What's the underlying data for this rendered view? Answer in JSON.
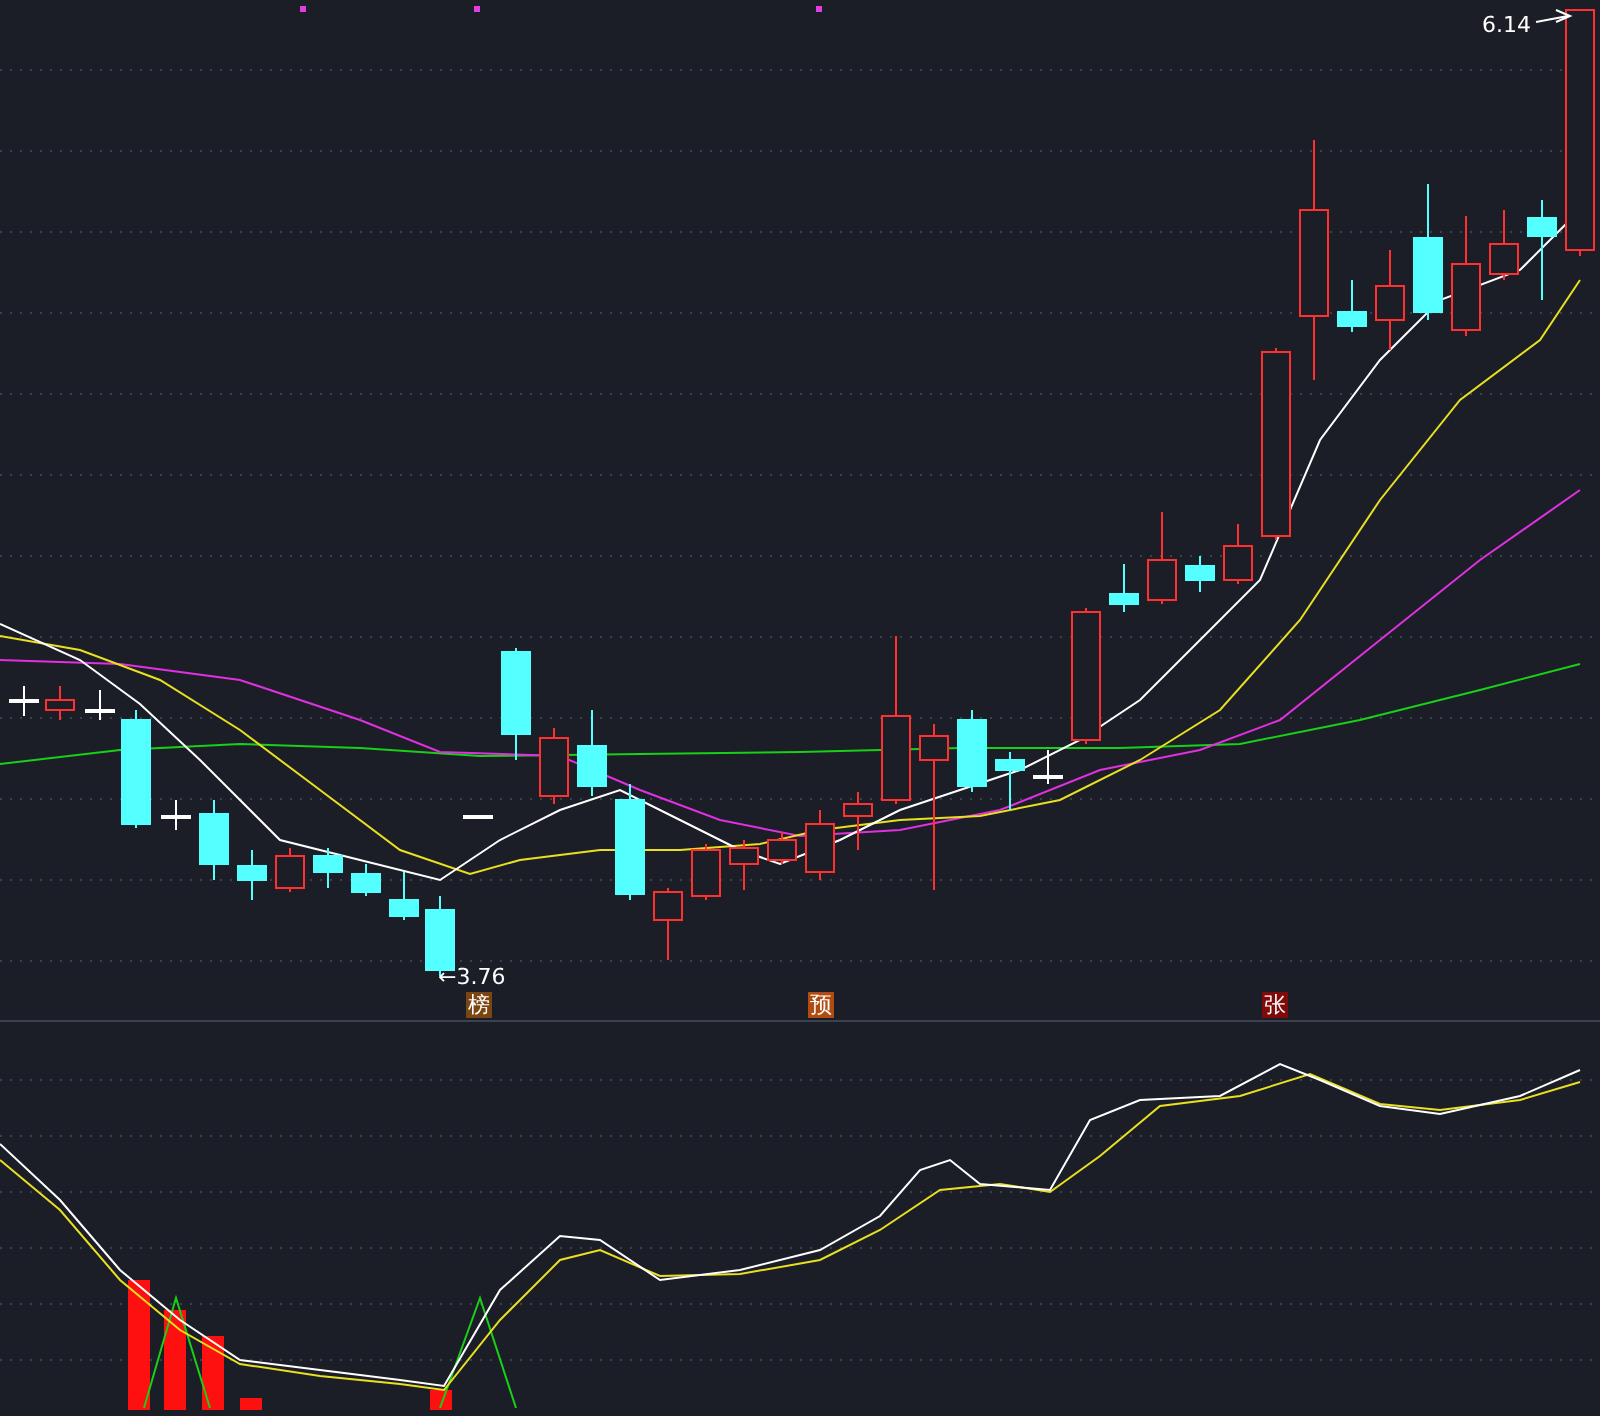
{
  "price_chart": {
    "high_label": "6.14",
    "low_label": "←3.76",
    "markers": [
      {
        "label": "榜",
        "color": "#7a4510"
      },
      {
        "label": "预",
        "color": "#b04c12"
      },
      {
        "label": "张",
        "color": "#7e0a0a"
      }
    ]
  }
}
